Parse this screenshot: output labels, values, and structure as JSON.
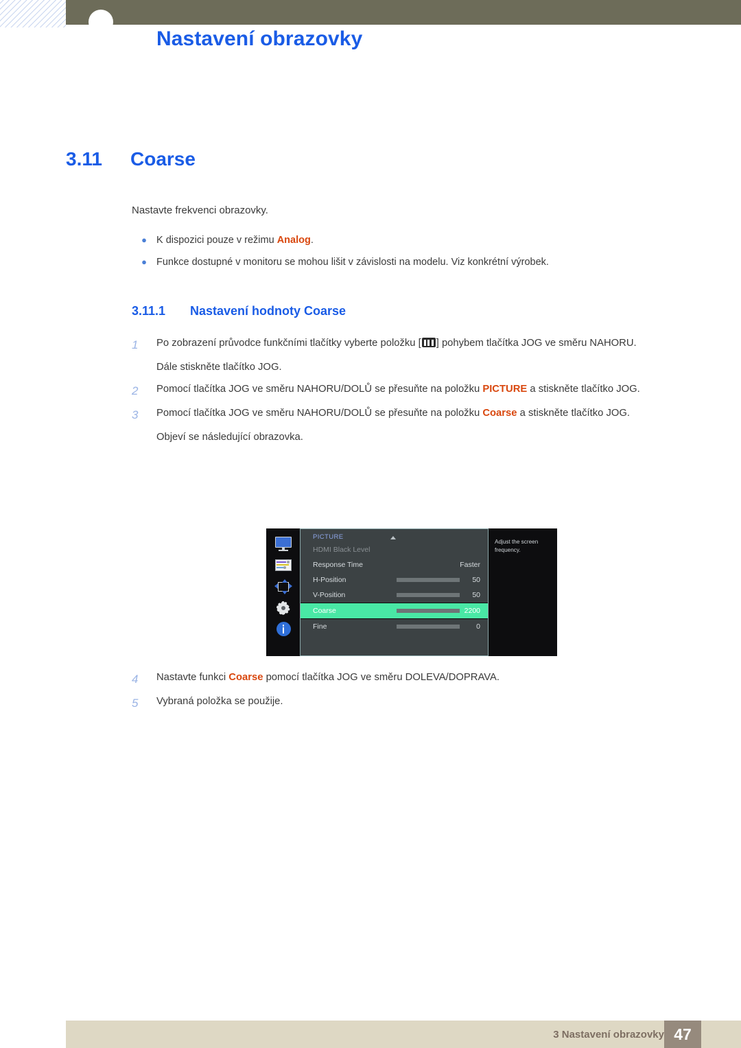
{
  "header": {
    "title": "Nastavení obrazovky",
    "accent_color": "#1a5ce6",
    "band_color": "#6d6c59"
  },
  "section": {
    "number": "3.11",
    "title": "Coarse"
  },
  "lead_text": "Nastavte frekvenci obrazovky.",
  "bullets": [
    {
      "before": "K dispozici pouze v režimu ",
      "highlight": "Analog",
      "after": "."
    },
    {
      "before": "Funkce dostupné v monitoru se mohou lišit v závislosti na modelu. Viz konkrétní výrobek.",
      "highlight": "",
      "after": ""
    }
  ],
  "subsection": {
    "number": "3.11.1",
    "title": "Nastavení hodnoty Coarse"
  },
  "steps": [
    {
      "num": "1",
      "text_before_icon": "Po zobrazení průvodce funkčními tlačítky vyberte položku [",
      "icon": "jog-menu-icon",
      "text_after_icon": "] pohybem tlačítka JOG ve směru NAHORU.",
      "sub": "Dále stiskněte tlačítko JOG."
    },
    {
      "num": "2",
      "part1": "Pomocí tlačítka JOG ve směru NAHORU/DOLŮ se přesuňte na položku ",
      "highlight": "PICTURE",
      "part2": " a stiskněte tlačítko JOG.",
      "sub": ""
    },
    {
      "num": "3",
      "part1": "Pomocí tlačítka JOG ve směru NAHORU/DOLŮ se přesuňte na položku ",
      "highlight": "Coarse",
      "part2": " a stiskněte tlačítko JOG.",
      "sub": "Objeví se následující obrazovka."
    }
  ],
  "steps_after": [
    {
      "num": "4",
      "part1": "Nastavte funkci ",
      "highlight": "Coarse",
      "part2": " pomocí tlačítka JOG ve směru DOLEVA/DOPRAVA."
    },
    {
      "num": "5",
      "part1": "Vybraná položka se použije.",
      "highlight": "",
      "part2": ""
    }
  ],
  "osd": {
    "title": "PICTURE",
    "highlight_color": "#49e8a5",
    "description": "Adjust the screen frequency.",
    "rail_icons": [
      "monitor-icon",
      "picture-settings-icon",
      "position-icon",
      "gear-icon",
      "info-icon"
    ],
    "rows": [
      {
        "label": "HDMI Black Level",
        "value": "",
        "bar": null,
        "state": "dim"
      },
      {
        "label": "Response Time",
        "value": "Faster",
        "bar": null,
        "state": "normal"
      },
      {
        "label": "H-Position",
        "value": "50",
        "bar": 50,
        "state": "normal"
      },
      {
        "label": "V-Position",
        "value": "50",
        "bar": 50,
        "state": "normal"
      },
      {
        "label": "Coarse",
        "value": "2200",
        "bar": 50,
        "state": "highlight"
      },
      {
        "label": "Fine",
        "value": "0",
        "bar": 0,
        "state": "normal"
      }
    ]
  },
  "footer": {
    "chapter": "3 Nastavení obrazovky",
    "page": "47",
    "bar_color": "#ded8c4",
    "page_box_color": "#968a7d"
  }
}
